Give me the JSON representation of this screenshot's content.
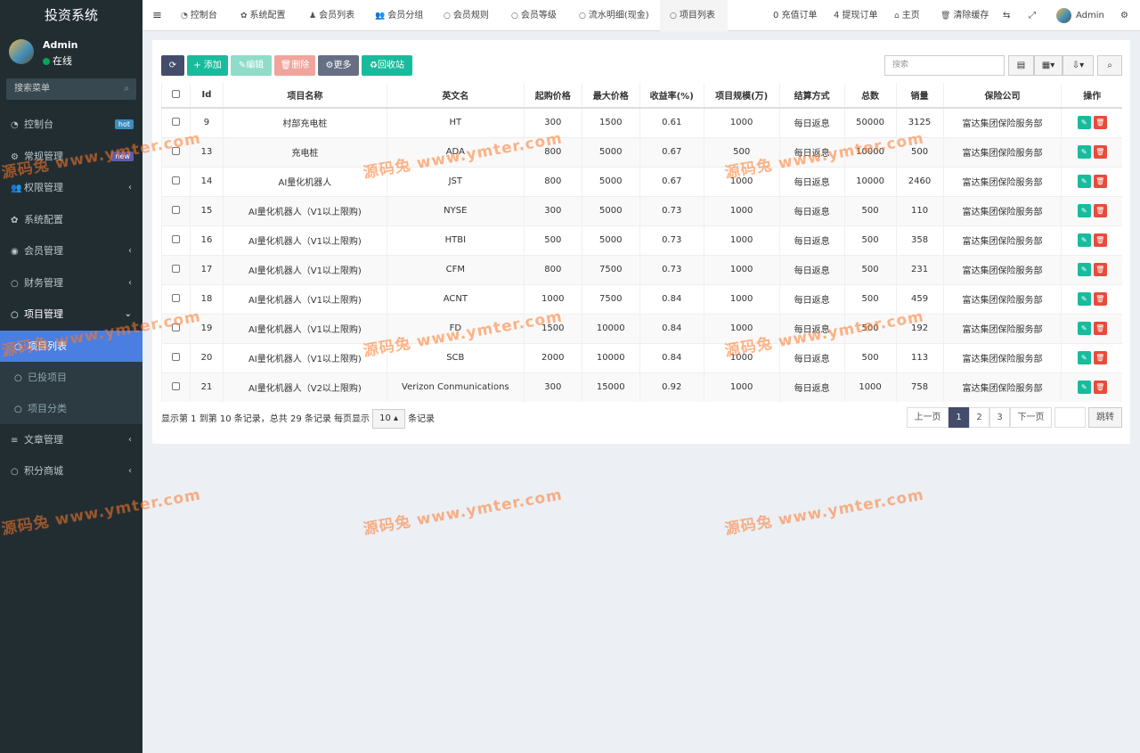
{
  "sidebar": {
    "logo": "投资系统",
    "user": {
      "name": "Admin",
      "status": "在线"
    },
    "search_placeholder": "搜索菜单",
    "items": [
      {
        "label": "控制台",
        "icon": "dashboard-icon",
        "badge": "hot"
      },
      {
        "label": "常规管理",
        "icon": "cogs-icon",
        "badge": "new"
      },
      {
        "label": "权限管理",
        "icon": "users-icon"
      },
      {
        "label": "系统配置",
        "icon": "gear-icon"
      },
      {
        "label": "会员管理",
        "icon": "user-circle-icon"
      },
      {
        "label": "财务管理",
        "icon": "circle-icon"
      },
      {
        "label": "项目管理",
        "icon": "circle-icon"
      }
    ],
    "subitems": [
      {
        "label": "项目列表"
      },
      {
        "label": "已投项目"
      },
      {
        "label": "项目分类"
      }
    ],
    "items_after": [
      {
        "label": "文章管理",
        "icon": "list-icon"
      },
      {
        "label": "积分商城",
        "icon": "circle-icon"
      }
    ]
  },
  "topbar": {
    "tabs": [
      "控制台",
      "系统配置",
      "会员列表",
      "会员分组",
      "会员规则",
      "会员等级",
      "流水明细(现金)",
      "项目列表"
    ],
    "right": [
      "0 充值订单",
      "4 提现订单",
      "主页",
      "清除缓存",
      "Admin"
    ]
  },
  "toolbar": {
    "add": "添加",
    "edit": "编辑",
    "delete": "删除",
    "more": "更多",
    "recycle": "回收站",
    "search_placeholder": "搜索"
  },
  "table": {
    "headers": [
      "Id",
      "项目名称",
      "英文名",
      "起购价格",
      "最大价格",
      "收益率(%)",
      "项目规模(万)",
      "结算方式",
      "总数",
      "销量",
      "保险公司",
      "操作"
    ],
    "rows": [
      [
        "9",
        "村部充电桩",
        "HT",
        "300",
        "1500",
        "0.61",
        "1000",
        "每日返息",
        "50000",
        "3125",
        "富达集团保险服务部"
      ],
      [
        "13",
        "充电桩",
        "ADA",
        "800",
        "5000",
        "0.67",
        "500",
        "每日返息",
        "10000",
        "500",
        "富达集团保险服务部"
      ],
      [
        "14",
        "AI量化机器人",
        "JST",
        "800",
        "5000",
        "0.67",
        "1000",
        "每日返息",
        "10000",
        "2460",
        "富达集团保险服务部"
      ],
      [
        "15",
        "AI量化机器人（V1以上限购)",
        "NYSE",
        "300",
        "5000",
        "0.73",
        "1000",
        "每日返息",
        "500",
        "110",
        "富达集团保险服务部"
      ],
      [
        "16",
        "AI量化机器人（V1以上限购)",
        "HTBI",
        "500",
        "5000",
        "0.73",
        "1000",
        "每日返息",
        "500",
        "358",
        "富达集团保险服务部"
      ],
      [
        "17",
        "AI量化机器人（V1以上限购)",
        "CFM",
        "800",
        "7500",
        "0.73",
        "1000",
        "每日返息",
        "500",
        "231",
        "富达集团保险服务部"
      ],
      [
        "18",
        "AI量化机器人（V1以上限购)",
        "ACNT",
        "1000",
        "7500",
        "0.84",
        "1000",
        "每日返息",
        "500",
        "459",
        "富达集团保险服务部"
      ],
      [
        "19",
        "AI量化机器人（V1以上限购)",
        "FD",
        "1500",
        "10000",
        "0.84",
        "1000",
        "每日返息",
        "500",
        "192",
        "富达集团保险服务部"
      ],
      [
        "20",
        "AI量化机器人（V1以上限购)",
        "SCB",
        "2000",
        "10000",
        "0.84",
        "1000",
        "每日返息",
        "500",
        "113",
        "富达集团保险服务部"
      ],
      [
        "21",
        "AI量化机器人（V2以上限购)",
        "Verizon Conmunications",
        "300",
        "15000",
        "0.92",
        "1000",
        "每日返息",
        "1000",
        "758",
        "富达集团保险服务部"
      ]
    ]
  },
  "footer": {
    "info_prefix": "显示第 1 到第 10 条记录，总共 29 条记录 每页显示",
    "page_size": "10",
    "info_suffix": "条记录",
    "prev": "上一页",
    "next": "下一页",
    "pages": [
      "1",
      "2",
      "3"
    ],
    "jump": "跳转"
  },
  "watermark": "源码兔 www.ymter.com"
}
